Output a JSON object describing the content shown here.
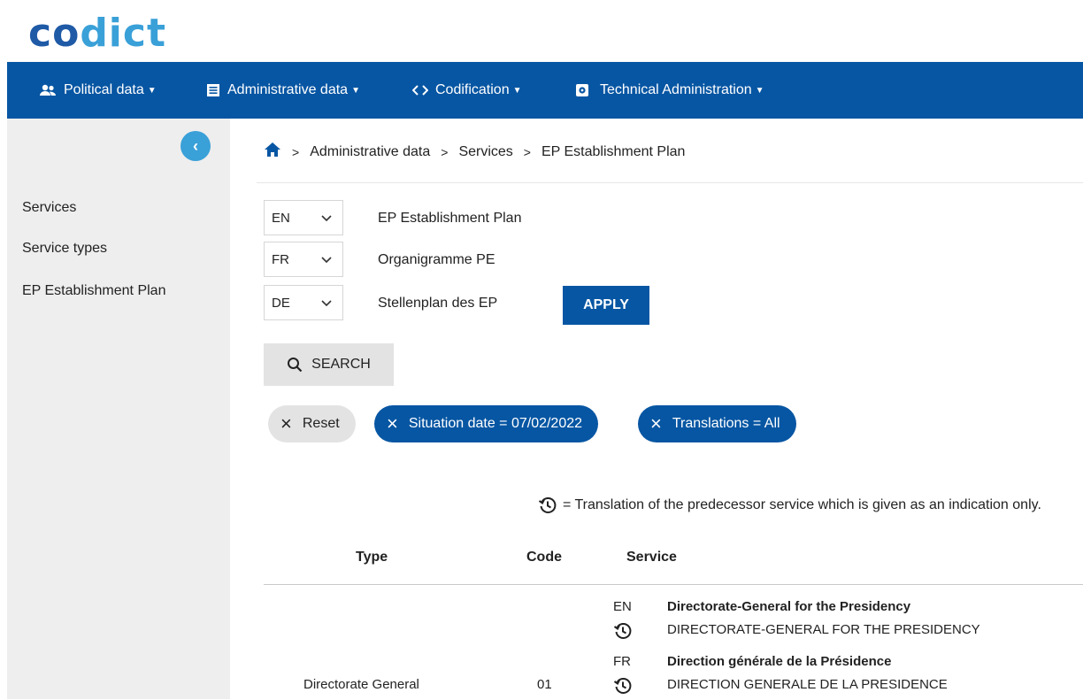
{
  "logo": {
    "part1": "co",
    "part2": "dict"
  },
  "nav": {
    "items": [
      {
        "label": "Political data",
        "icon": "users-icon"
      },
      {
        "label": "Administrative data",
        "icon": "document-list-icon"
      },
      {
        "label": "Codification",
        "icon": "code-brackets-icon"
      },
      {
        "label": "Technical Administration",
        "icon": "gear-box-icon"
      }
    ]
  },
  "sidebar": {
    "collapse_glyph": "‹",
    "items": [
      {
        "label": "Services"
      },
      {
        "label": "Service types"
      },
      {
        "label": "EP Establishment Plan"
      }
    ]
  },
  "breadcrumb": {
    "separator": ">",
    "items": [
      "Administrative data",
      "Services",
      "EP Establishment Plan"
    ]
  },
  "languages": [
    {
      "code": "EN",
      "label": "EP Establishment Plan"
    },
    {
      "code": "FR",
      "label": "Organigramme PE"
    },
    {
      "code": "DE",
      "label": "Stellenplan des EP"
    }
  ],
  "apply_label": "APPLY",
  "search_label": "SEARCH",
  "filters": {
    "reset_label": "Reset",
    "chips": [
      "Situation date = 07/02/2022",
      "Translations = All"
    ]
  },
  "legend": {
    "text": "= Translation of the predecessor service which is given as an indication only."
  },
  "table": {
    "headers": {
      "type": "Type",
      "code": "Code",
      "service": "Service"
    },
    "row": {
      "type": "Directorate General",
      "code": "01",
      "translations": [
        {
          "lang": "EN",
          "name": "Directorate-General for the Presidency",
          "predecessor": "DIRECTORATE-GENERAL FOR THE PRESIDENCY"
        },
        {
          "lang": "FR",
          "name": "Direction générale de la Présidence",
          "predecessor": "DIRECTION GENERALE DE LA PRESIDENCE"
        }
      ]
    }
  },
  "colors": {
    "primary": "#0756a3",
    "accent": "#3aa0d8",
    "sidebar_bg": "#eeeeee"
  }
}
